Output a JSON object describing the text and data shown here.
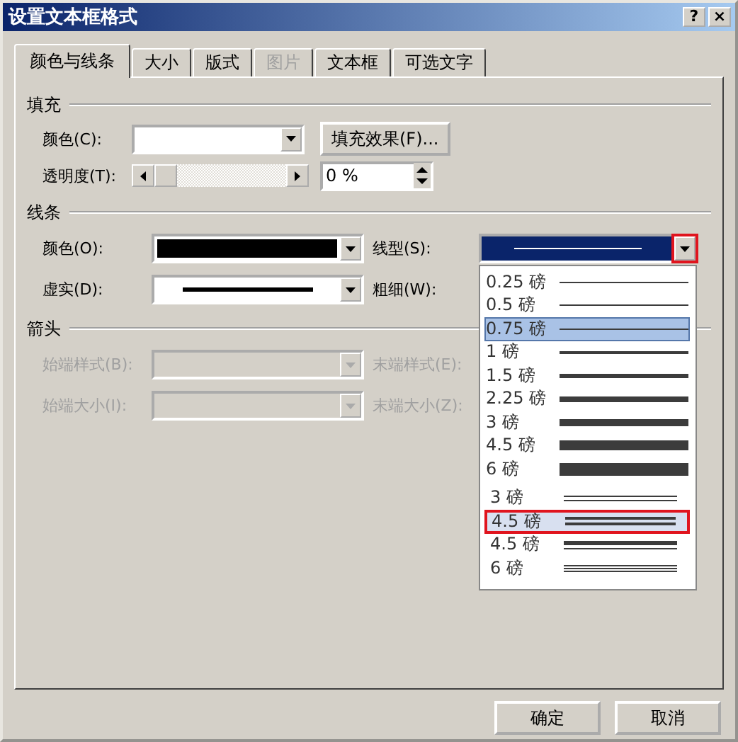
{
  "window": {
    "title": "设置文本框格式",
    "help_button": "?",
    "close_button": "×"
  },
  "tabs": [
    {
      "label": "颜色与线条",
      "selected": true,
      "disabled": false
    },
    {
      "label": "大小",
      "selected": false,
      "disabled": false
    },
    {
      "label": "版式",
      "selected": false,
      "disabled": false
    },
    {
      "label": "图片",
      "selected": false,
      "disabled": true
    },
    {
      "label": "文本框",
      "selected": false,
      "disabled": false
    },
    {
      "label": "可选文字",
      "selected": false,
      "disabled": false
    }
  ],
  "fill": {
    "heading": "填充",
    "color_label": "颜色(C):",
    "effects_button": "填充效果(F)...",
    "transparency_label": "透明度(T):",
    "transparency": {
      "level": 0
    },
    "transparency_value": "0 %"
  },
  "line": {
    "heading": "线条",
    "color_label": "颜色(O):",
    "color": "#000000",
    "style_label": "线型(S):",
    "dash_label": "虚实(D):",
    "weight_label": "粗细(W):",
    "style_dropdown": {
      "arrow_highlighted": true,
      "options": [
        {
          "label": "0.25 磅",
          "kind": "hairline",
          "selected": false,
          "highlighted": false
        },
        {
          "label": "0.5 磅",
          "kind": "thin",
          "selected": false,
          "highlighted": false
        },
        {
          "label": "0.75 磅",
          "kind": "light",
          "selected": true,
          "highlighted": false
        },
        {
          "label": "1 磅",
          "kind": "regular",
          "selected": false,
          "highlighted": false
        },
        {
          "label": "1.5 磅",
          "kind": "medium",
          "selected": false,
          "highlighted": false
        },
        {
          "label": "2.25 磅",
          "kind": "heavy",
          "selected": false,
          "highlighted": false
        },
        {
          "label": "3 磅",
          "kind": "bold",
          "selected": false,
          "highlighted": false
        },
        {
          "label": "4.5 磅",
          "kind": "thick",
          "selected": false,
          "highlighted": false
        },
        {
          "label": "6 磅",
          "kind": "thickest",
          "selected": false,
          "highlighted": false
        },
        {
          "label": "3 磅",
          "kind": "double",
          "selected": false,
          "highlighted": false
        },
        {
          "label": "4.5 磅",
          "kind": "double-thick",
          "selected": false,
          "highlighted": true
        },
        {
          "label": "4.5 磅",
          "kind": "thick-thin",
          "selected": false,
          "highlighted": false
        },
        {
          "label": "6 磅",
          "kind": "triple",
          "selected": false,
          "highlighted": false
        }
      ]
    }
  },
  "arrows": {
    "heading": "箭头",
    "begin_style_label": "始端样式(B):",
    "end_style_label": "末端样式(E):",
    "begin_size_label": "始端大小(I):",
    "end_size_label": "末端大小(Z):",
    "disabled": true
  },
  "buttons": [
    {
      "label": "确定"
    },
    {
      "label": "取消"
    }
  ]
}
